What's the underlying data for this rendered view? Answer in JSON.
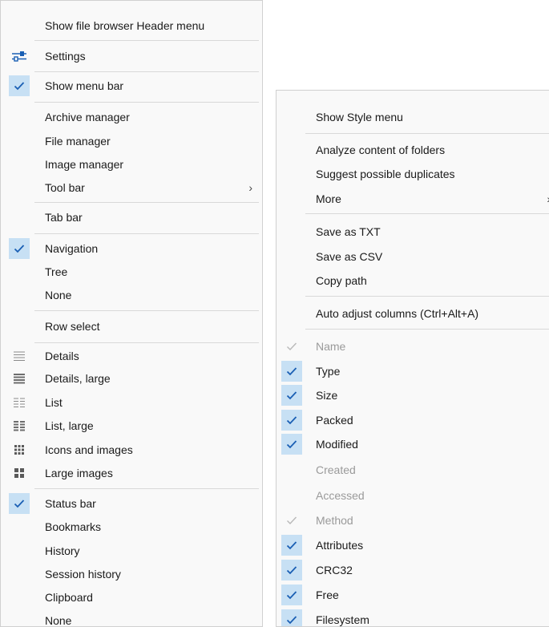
{
  "colors": {
    "check_bg": "#c7e0f4",
    "check_mark": "#1a5fb4",
    "disabled_text": "#9a9a9a",
    "separator": "#d9d9d9",
    "menu_bg": "#f9f9f9"
  },
  "left_menu": {
    "items": [
      {
        "label": "Show file browser Header menu",
        "icon": "none"
      },
      {
        "label": "Settings",
        "icon": "settings-sliders-icon"
      },
      {
        "label": "Show menu bar",
        "icon": "checkmark-icon",
        "checked": true
      },
      {
        "label": "Archive manager",
        "icon": "none"
      },
      {
        "label": "File manager",
        "icon": "none"
      },
      {
        "label": "Image manager",
        "icon": "none"
      },
      {
        "label": "Tool bar",
        "icon": "none",
        "submenu": true
      },
      {
        "label": "Tab bar",
        "icon": "none"
      },
      {
        "label": "Navigation",
        "icon": "checkmark-icon",
        "checked": true
      },
      {
        "label": "Tree",
        "icon": "none"
      },
      {
        "label": "None",
        "icon": "none"
      },
      {
        "label": "Row select",
        "icon": "none"
      },
      {
        "label": "Details",
        "icon": "details-view-icon"
      },
      {
        "label": "Details, large",
        "icon": "details-large-view-icon"
      },
      {
        "label": "List",
        "icon": "list-view-icon"
      },
      {
        "label": "List, large",
        "icon": "list-large-view-icon"
      },
      {
        "label": "Icons and images",
        "icon": "icons-grid-icon"
      },
      {
        "label": "Large images",
        "icon": "large-images-grid-icon"
      },
      {
        "label": "Status bar",
        "icon": "checkmark-icon",
        "checked": true
      },
      {
        "label": "Bookmarks",
        "icon": "none"
      },
      {
        "label": "History",
        "icon": "none"
      },
      {
        "label": "Session history",
        "icon": "none"
      },
      {
        "label": "Clipboard",
        "icon": "none"
      },
      {
        "label": "None",
        "icon": "none"
      }
    ]
  },
  "right_menu": {
    "items": [
      {
        "label": "Show Style menu",
        "icon": "none"
      },
      {
        "label": "Analyze content of folders",
        "icon": "none"
      },
      {
        "label": "Suggest possible duplicates",
        "icon": "none"
      },
      {
        "label": "More",
        "icon": "none",
        "submenu": true
      },
      {
        "label": "Save as TXT",
        "icon": "none"
      },
      {
        "label": "Save as CSV",
        "icon": "none"
      },
      {
        "label": "Copy path",
        "icon": "none"
      },
      {
        "label": "Auto adjust columns (Ctrl+Alt+A)",
        "icon": "none"
      },
      {
        "label": "Name",
        "icon": "checkmark-icon",
        "checked": true,
        "disabled": true
      },
      {
        "label": "Type",
        "icon": "checkmark-icon",
        "checked": true
      },
      {
        "label": "Size",
        "icon": "checkmark-icon",
        "checked": true
      },
      {
        "label": "Packed",
        "icon": "checkmark-icon",
        "checked": true
      },
      {
        "label": "Modified",
        "icon": "checkmark-icon",
        "checked": true
      },
      {
        "label": "Created",
        "icon": "none",
        "disabled": true
      },
      {
        "label": "Accessed",
        "icon": "none",
        "disabled": true
      },
      {
        "label": "Method",
        "icon": "checkmark-icon",
        "checked": true,
        "disabled": true
      },
      {
        "label": "Attributes",
        "icon": "checkmark-icon",
        "checked": true
      },
      {
        "label": "CRC32",
        "icon": "checkmark-icon",
        "checked": true
      },
      {
        "label": "Free",
        "icon": "checkmark-icon",
        "checked": true
      },
      {
        "label": "Filesystem",
        "icon": "checkmark-icon",
        "checked": true
      }
    ]
  }
}
